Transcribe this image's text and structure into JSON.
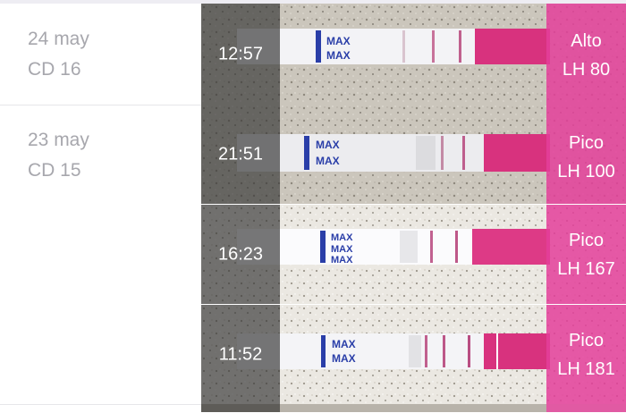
{
  "colors": {
    "accent": "#e43e9a",
    "muted_text": "#a7a7ad",
    "max_text": "#2a3ea8"
  },
  "days": [
    {
      "date": "24 may",
      "cycle_day": "CD 16",
      "tests": [
        {
          "time": "12:57",
          "level": "Alto",
          "lh": "LH 80",
          "max_marks": [
            "MAX",
            "MAX"
          ],
          "photo": "granite-dark",
          "line_intensity": 0.5
        }
      ]
    },
    {
      "date": "23 may",
      "cycle_day": "CD 15",
      "tests": [
        {
          "time": "21:51",
          "level": "Pico",
          "lh": "LH 100",
          "max_marks": [
            "MAX",
            "MAX"
          ],
          "photo": "granite-dark",
          "line_intensity": 0.6
        },
        {
          "time": "16:23",
          "level": "Pico",
          "lh": "LH 167",
          "max_marks": [
            "MAX",
            "MAX",
            "MAX"
          ],
          "photo": "granite-light",
          "line_intensity": 0.75
        },
        {
          "time": "11:52",
          "level": "Pico",
          "lh": "LH 181",
          "max_marks": [
            "MAX",
            "MAX"
          ],
          "photo": "granite-light",
          "line_intensity": 0.85
        }
      ]
    }
  ]
}
